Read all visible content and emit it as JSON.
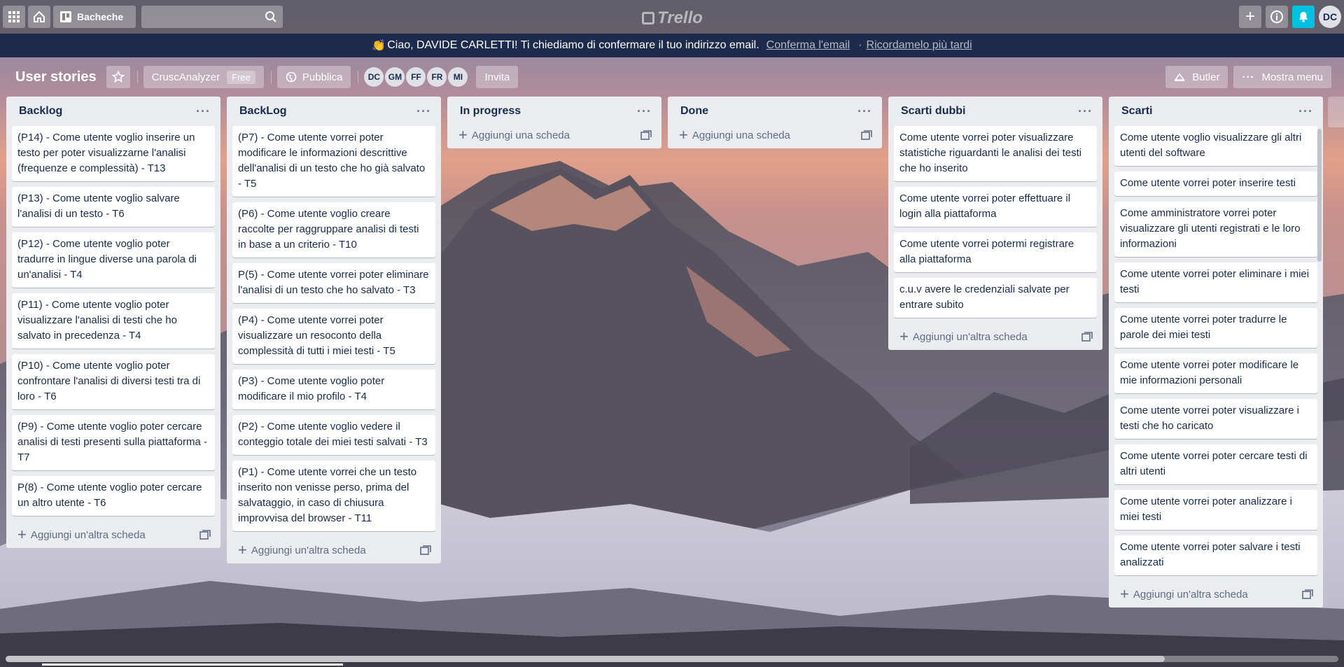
{
  "header": {
    "boards_label": "Bacheche",
    "search_placeholder": "",
    "logo_text": "Trello",
    "user_initials": "DC"
  },
  "banner": {
    "emoji": "👏",
    "message": "Ciao, DAVIDE CARLETTI! Ti chiediamo di confermare il tuo indirizzo email.",
    "confirm_link": "Conferma l'email",
    "separator": "·",
    "later_link": "Ricordamelo più tardi"
  },
  "board": {
    "title": "User stories",
    "team": "CruscAnalyzer",
    "team_badge": "Free",
    "visibility": "Pubblica",
    "members": [
      "DC",
      "GM",
      "FF",
      "FR",
      "MI"
    ],
    "invite_label": "Invita",
    "butler_label": "Butler",
    "show_menu_label": "Mostra menu"
  },
  "lists": [
    {
      "title": "Backlog",
      "cards": [
        "(P14) - Come utente voglio inserire un testo per poter visualizzarne l'analisi (frequenze e complessità) - T13",
        "(P13) - Come utente voglio salvare l'analisi di un testo - T6",
        "(P12) - Come utente voglio poter tradurre in lingue diverse una parola di un'analisi - T4",
        "(P11) - Come utente voglio poter visualizzare l'analisi di testi che ho salvato in precedenza - T4",
        "(P10) - Come utente voglio poter confrontare l'analisi di diversi testi tra di loro - T6",
        "(P9) - Come utente voglio poter cercare analisi di testi presenti sulla piattaforma - T7",
        "P(8) - Come utente voglio poter cercare un altro utente - T6"
      ],
      "add_label": "Aggiungi un'altra scheda"
    },
    {
      "title": "BackLog",
      "cards": [
        "(P7) - Come utente vorrei poter modificare le informazioni descrittive dell'analisi di un testo che ho già salvato - T5",
        "(P6) - Come utente voglio creare raccolte per raggruppare analisi di testi in base a un criterio - T10",
        "P(5) - Come utente vorrei poter eliminare l'analisi di un testo che ho salvato - T3",
        "(P4) - Come utente vorrei poter visualizzare un resoconto della complessità di tutti i miei testi - T5",
        "(P3) - Come utente voglio poter modificare il mio profilo - T4",
        "(P2) - Come utente voglio vedere il conteggio totale dei miei testi salvati - T3",
        "(P1) - Come utente vorrei che un testo inserito non venisse perso, prima del salvataggio, in caso di chiusura improvvisa del browser - T11"
      ],
      "add_label": "Aggiungi un'altra scheda"
    },
    {
      "title": "In progress",
      "cards": [],
      "add_label": "Aggiungi una scheda"
    },
    {
      "title": "Done",
      "cards": [],
      "add_label": "Aggiungi una scheda"
    },
    {
      "title": "Scarti dubbi",
      "cards": [
        "Come utente vorrei poter visualizzare statistiche riguardanti le analisi dei testi che ho inserito",
        "Come utente vorrei poter effettuare il login alla piattaforma",
        "Come utente vorrei potermi registrare alla piattaforma",
        "c.u.v avere le credenziali salvate per entrare subito"
      ],
      "add_label": "Aggiungi un'altra scheda"
    },
    {
      "title": "Scarti",
      "cards": [
        "Come utente voglio visualizzare gli altri utenti del software",
        "Come utente vorrei poter inserire testi",
        "Come amministratore vorrei poter visualizzare gli utenti registrati e le loro informazioni",
        "Come utente vorrei poter eliminare i miei testi",
        "Come utente vorrei poter tradurre le parole dei miei testi",
        "Come utente vorrei poter modificare le mie informazioni personali",
        "Come utente vorrei poter visualizzare i testi che ho caricato",
        "Come utente vorrei poter cercare testi di altri utenti",
        "Come utente vorrei poter analizzare i miei testi",
        "Come utente vorrei poter salvare i testi analizzati"
      ],
      "add_label": "Aggiungi un'altra scheda"
    }
  ]
}
